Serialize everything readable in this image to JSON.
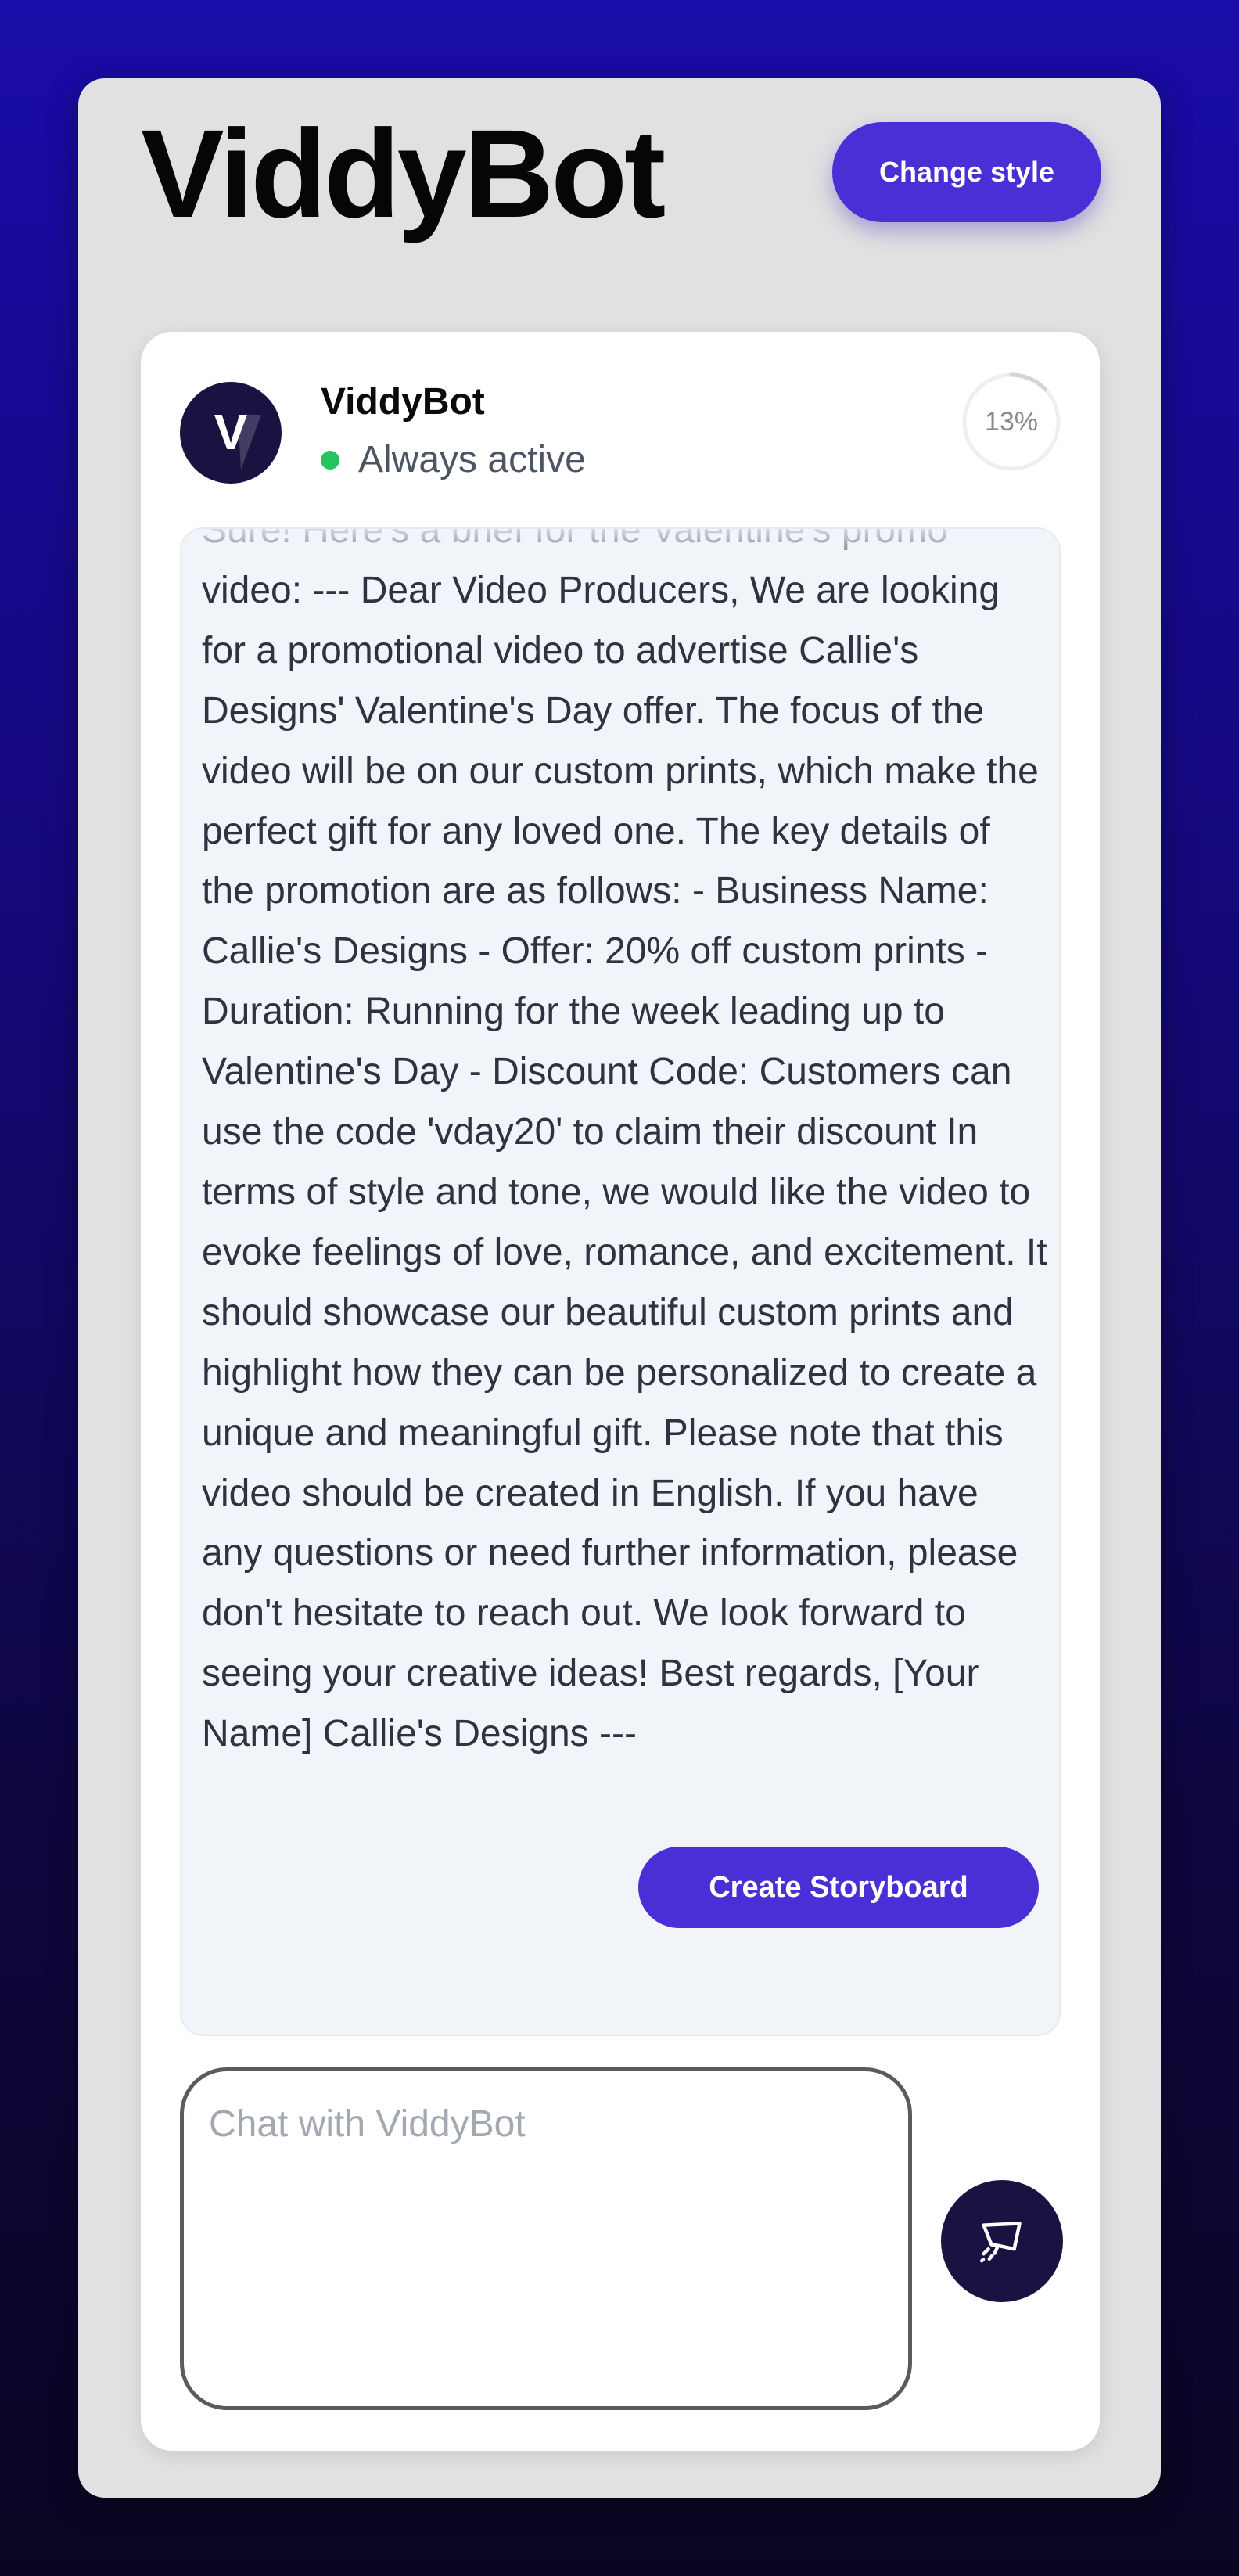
{
  "header": {
    "title": "ViddyBot",
    "change_style_label": "Change style"
  },
  "chat": {
    "bot_name": "ViddyBot",
    "avatar_letter": "V",
    "status": "Always active",
    "status_color": "#22c55e",
    "progress": 13,
    "progress_label": "13%",
    "message": "Sure! Here's a brief for the Valentine's promo video: --- Dear Video Producers, We are looking for a promotional video to advertise Callie's Designs' Valentine's Day offer. The focus of the video will be on our custom prints, which make the perfect gift for any loved one. The key details of the promotion are as follows: - Business Name: Callie's Designs - Offer: 20% off custom prints - Duration: Running for the week leading up to Valentine's Day - Discount Code: Customers can use the code 'vday20' to claim their discount In terms of style and tone, we would like the video to evoke feelings of love, romance, and excitement. It should showcase our beautiful custom prints and highlight how they can be personalized to create a unique and meaningful gift. Please note that this video should be created in English. If you have any questions or need further information, please don't hesitate to reach out. We look forward to seeing your creative ideas! Best regards, [Your Name] Callie's Designs ---",
    "create_storyboard_label": "Create Storyboard"
  },
  "input": {
    "placeholder": "Chat with ViddyBot",
    "value": ""
  },
  "icons": {
    "send": "send-chat-icon",
    "progress": "progress-ring-icon"
  },
  "colors": {
    "accent": "#4a2fd6",
    "dark": "#1b1241",
    "background_top": "#1a0ca8",
    "background_bottom": "#0a0622",
    "panel": "#e1e1e1"
  }
}
